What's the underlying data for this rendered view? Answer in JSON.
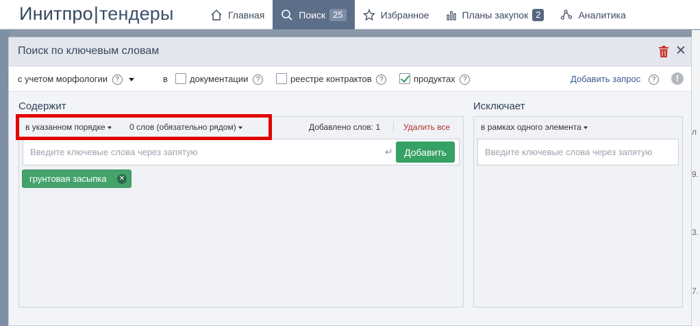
{
  "logo": {
    "part1": "Инитпро",
    "separator": "|",
    "part2": "тендеры"
  },
  "nav": {
    "items": [
      {
        "label": "Главная",
        "icon": "home-icon"
      },
      {
        "label": "Поиск",
        "icon": "search-icon",
        "badge": "25",
        "active": true
      },
      {
        "label": "Избранное",
        "icon": "star-icon"
      },
      {
        "label": "Планы закупок",
        "icon": "bar-chart-icon",
        "badge": "2"
      },
      {
        "label": "Аналитика",
        "icon": "analytics-icon"
      }
    ]
  },
  "background": {
    "right_values": [
      "л",
      "9.",
      "3.",
      "7."
    ]
  },
  "modal": {
    "title": "Поиск по ключевым словам",
    "options": {
      "morphology": "с учетом морфологии",
      "in_label": "в",
      "documentation": {
        "label": "документации",
        "checked": false
      },
      "contracts_registry": {
        "label": "реестре контрактов",
        "checked": false
      },
      "products": {
        "label": "продуктах",
        "checked": true
      },
      "add_query": "Добавить запрос",
      "help": "?",
      "warn": "!"
    },
    "contains": {
      "title": "Содержит",
      "order_mode": "в указанном порядке",
      "distance_mode": "0 слов (обязательно рядом)",
      "added_words": "Добавлено слов: 1",
      "delete_all": "Удалить все",
      "input_placeholder": "Введите ключевые слова через запятую",
      "enter_glyph": "↵",
      "add_button": "Добавить",
      "tags": [
        {
          "label": "грунтовая засыпка",
          "remove": "✕"
        }
      ]
    },
    "excludes": {
      "title": "Исключает",
      "scope_mode": "в рамках одного элемента",
      "input_placeholder": "Введите ключевые слова через запятую"
    }
  },
  "colors": {
    "nav_active_bg": "#5d6e88",
    "add_button_bg": "#36a165",
    "tag_bg": "#43a36b",
    "delete_text": "#b0342c",
    "highlight": "#e00000"
  }
}
